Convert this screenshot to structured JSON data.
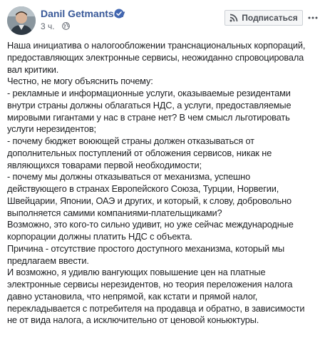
{
  "post": {
    "author": "Danil Getmantsev",
    "time": "3 ч.",
    "privacy_icon": "globe-icon",
    "verified_icon": "verified-badge-icon",
    "subscribe_label": "Подписаться",
    "colors": {
      "link": "#385898",
      "text": "#1c1e21",
      "meta": "#616770",
      "badge": "#4267b2"
    },
    "lines": [
      "Наша инициатива о налогообложении транснациональных корпораций,",
      "предоставляющих электронные сервисы, неожиданно спровоцировала",
      "вал критики.",
      "Честно, не могу объяснить почему:",
      "- рекламные и информационные услуги, оказываемые резидентами",
      "внутри страны должны облагаться НДС, а услуги, предоставляемые",
      "мировыми гигантами у нас в стране нет? В чем смысл льготировать",
      "услуги нерезидентов;",
      "- почему бюджет воюющей страны должен отказываться от",
      "дополнительных поступлений от обложения сервисов, никак не",
      "являющихся товарами первой необходимости;",
      "- почему мы должны отказываться от механизма, успешно",
      "действующего в странах Европейского Союза, Турции, Норвегии,",
      "Швейцарии, Японии, ОАЭ и других, и который, к слову, добровольно",
      "выполняется самими компаниями-плательщиками?",
      "Возможно, это кого-то сильно удивит, но уже сейчас международные",
      "корпорации должны платить НДС с объекта.",
      "Причина - отсутствие простого доступного механизма, который мы",
      "предлагаем ввести.",
      "И возможно, я удивлю вангующих повышение цен на платные",
      "электронные сервисы нерезидентов, но теория переложения налога",
      "давно установила, что непрямой, как кстати и прямой налог,",
      "перекладывается с потребителя на продавца и обратно, в зависимости",
      "не от вида налога, а исключительно от ценовой коньюктуры."
    ]
  }
}
